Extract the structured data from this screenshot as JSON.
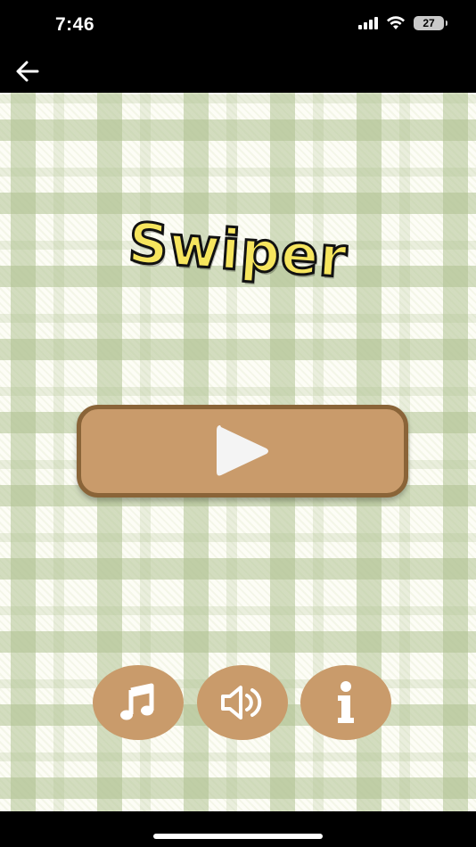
{
  "status_bar": {
    "time": "7:46",
    "battery_level": "27"
  },
  "nav": {
    "back_icon": "arrow-left-icon"
  },
  "game": {
    "title": "Swiper",
    "play_icon": "play-icon",
    "buttons": [
      {
        "icon": "music-note-icon"
      },
      {
        "icon": "speaker-icon"
      },
      {
        "icon": "info-icon"
      }
    ]
  },
  "colors": {
    "button_fill": "#c99b6b",
    "button_border": "#8a6438",
    "title_fill": "#f6e55e",
    "plaid_green": "#b0c292",
    "background": "#fdfdf6"
  }
}
